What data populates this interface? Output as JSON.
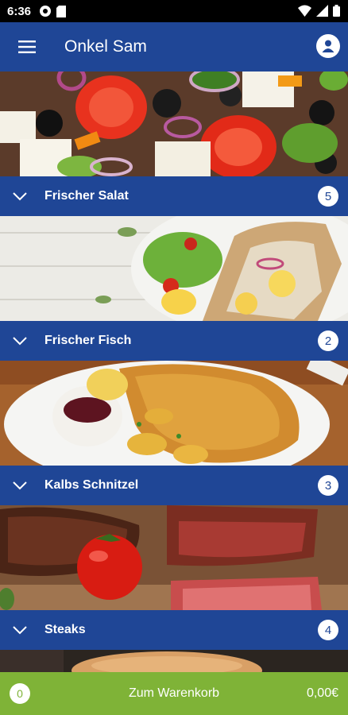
{
  "status_bar": {
    "time": "6:36"
  },
  "app_bar": {
    "title": "Onkel Sam"
  },
  "categories": [
    {
      "label": "Frischer Salat",
      "count": "5",
      "image": "salad-photo"
    },
    {
      "label": "Frischer Fisch",
      "count": "2",
      "image": "fish-photo"
    },
    {
      "label": "Kalbs Schnitzel",
      "count": "3",
      "image": "schnitzel-photo"
    },
    {
      "label": "Steaks",
      "count": "4",
      "image": "steak-photo"
    }
  ],
  "cart": {
    "count": "0",
    "label": "Zum Warenkorb",
    "total": "0,00€"
  },
  "colors": {
    "primary": "#1f4696",
    "cart": "#7fb337"
  }
}
